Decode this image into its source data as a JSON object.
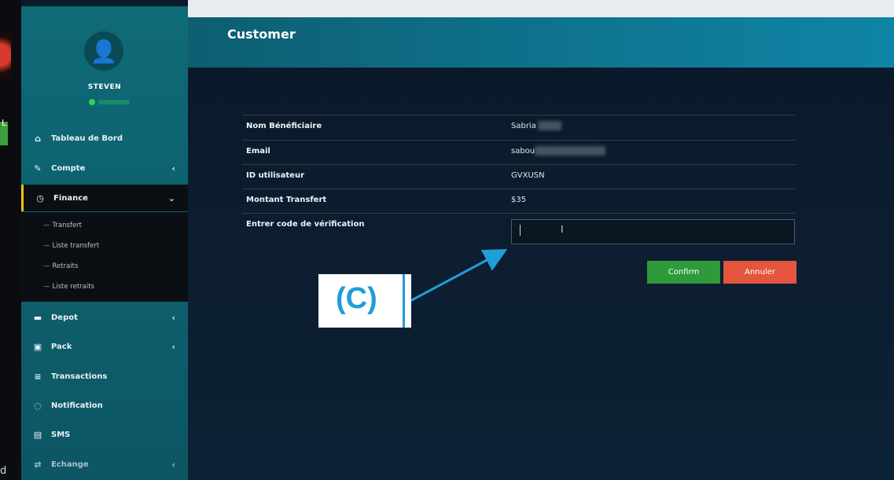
{
  "user": {
    "name": "STEVEN"
  },
  "sidebar": {
    "items": [
      {
        "label": "Tableau de Bord",
        "icon": "home-icon",
        "glyph": "⌂"
      },
      {
        "label": "Compte",
        "icon": "wrench-icon",
        "glyph": "✎",
        "chevron": "‹"
      },
      {
        "label": "Finance",
        "icon": "clock-icon",
        "glyph": "◷",
        "chevron": "⌄"
      },
      {
        "label": "Depot",
        "icon": "card-icon",
        "glyph": "▬",
        "chevron": "‹"
      },
      {
        "label": "Pack",
        "icon": "cube-icon",
        "glyph": "▣",
        "chevron": "‹"
      },
      {
        "label": "Transactions",
        "icon": "list-icon",
        "glyph": "≡"
      },
      {
        "label": "Notification",
        "icon": "chat-icon",
        "glyph": "◌"
      },
      {
        "label": "SMS",
        "icon": "sms-icon",
        "glyph": "▤"
      },
      {
        "label": "Echange",
        "icon": "exchange-icon",
        "glyph": "⇄",
        "chevron": "‹"
      }
    ],
    "finance_sub": [
      "Transfert",
      "Liste transfert",
      "Retraits",
      "Liste retraits"
    ]
  },
  "page": {
    "title": "Customer"
  },
  "details": [
    {
      "label": "Nom Bénéficiaire",
      "value": "Sabria"
    },
    {
      "label": "Email",
      "value": "sabou"
    },
    {
      "label": "ID utilisateur",
      "value": "GVXUSN"
    },
    {
      "label": "Montant Transfert",
      "value": "$35"
    },
    {
      "label": "Entrer code de vérification",
      "value": ""
    }
  ],
  "buttons": {
    "confirm": "Confirm",
    "cancel": "Annuler"
  },
  "annotation": {
    "label": "(C)"
  },
  "colors": {
    "sidebar": "#0f6a78",
    "confirm": "#2e9a3a",
    "cancel": "#e4553e",
    "accent": "#1f9ed8",
    "active_marker": "#f1c40f"
  }
}
